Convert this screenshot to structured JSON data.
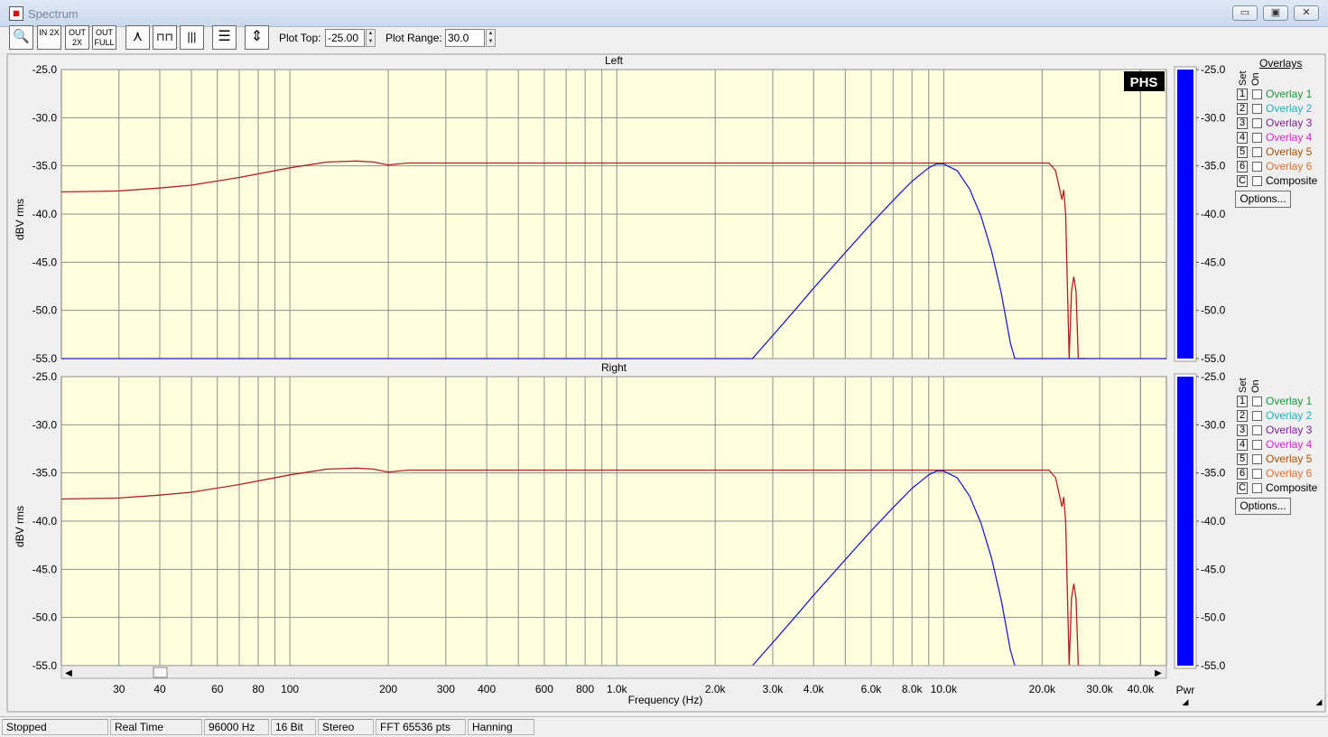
{
  "window": {
    "title": "Spectrum",
    "minimize": "▭",
    "maximize": "▣",
    "close": "✕"
  },
  "toolbar": {
    "buttons": [
      {
        "name": "zoom",
        "label": "🔍"
      },
      {
        "name": "in2x",
        "label": "IN 2X"
      },
      {
        "name": "out2x",
        "label": "OUT 2X"
      },
      {
        "name": "outfull",
        "label": "OUT FULL"
      },
      {
        "name": "peak",
        "label": "⋏"
      },
      {
        "name": "bars",
        "label": "⊓⊓"
      },
      {
        "name": "bargraph",
        "label": "|||"
      },
      {
        "name": "table",
        "label": "☰"
      },
      {
        "name": "range",
        "label": "⇕"
      }
    ],
    "plot_top_label": "Plot Top:",
    "plot_top_value": "-25.00",
    "plot_range_label": "Plot Range:",
    "plot_range_value": "30.0"
  },
  "chart_data": [
    {
      "type": "line",
      "title": "Left",
      "xlabel": "Frequency (Hz)",
      "ylabel": "dBV rms",
      "xscale": "log",
      "xlim": [
        20,
        48000
      ],
      "ylim": [
        -55,
        -25
      ],
      "yticks": [
        "-25.0",
        "-30.0",
        "-35.0",
        "-40.0",
        "-45.0",
        "-50.0",
        "-55.0"
      ],
      "xticks": [
        "30",
        "40",
        "60",
        "80",
        "100",
        "200",
        "300",
        "400",
        "600",
        "800",
        "1.0k",
        "2.0k",
        "3.0k",
        "4.0k",
        "6.0k",
        "8.0k",
        "10.0k",
        "20.0k",
        "30.0k",
        "40.0k"
      ],
      "xtick_values": [
        30,
        40,
        60,
        80,
        100,
        200,
        300,
        400,
        600,
        800,
        1000,
        2000,
        3000,
        4000,
        6000,
        8000,
        10000,
        20000,
        30000,
        40000
      ],
      "series": [
        {
          "color": "#b02020",
          "x": [
            20,
            30,
            40,
            50,
            70,
            100,
            130,
            160,
            180,
            200,
            230,
            300,
            1000,
            5000,
            10000,
            20000,
            21000,
            22000,
            23000,
            23300,
            23600,
            24200,
            24600,
            25000,
            25400,
            25800,
            26000,
            27000
          ],
          "y": [
            -37.7,
            -37.6,
            -37.3,
            -37.0,
            -36.2,
            -35.2,
            -34.6,
            -34.5,
            -34.6,
            -34.9,
            -34.7,
            -34.7,
            -34.7,
            -34.7,
            -34.7,
            -34.7,
            -34.7,
            -35.5,
            -38.5,
            -37.5,
            -40,
            -55,
            -48,
            -46.5,
            -48,
            -55,
            -55,
            -55
          ]
        },
        {
          "color": "#2020c0",
          "x": [
            20,
            2600,
            3000,
            3500,
            4000,
            5000,
            6000,
            7000,
            8000,
            9000,
            9500,
            10000,
            11000,
            12000,
            13000,
            14000,
            15000,
            16000,
            16500,
            17000,
            48000
          ],
          "y": [
            -55,
            -55,
            -52.6,
            -50.0,
            -47.7,
            -44.0,
            -41.0,
            -38.6,
            -36.6,
            -35.2,
            -34.8,
            -34.8,
            -35.5,
            -37.4,
            -40.2,
            -43.8,
            -48.2,
            -53.4,
            -55,
            -55,
            -55
          ]
        }
      ],
      "logo": "PHS"
    },
    {
      "type": "line",
      "title": "Right",
      "xlabel": "Frequency (Hz)",
      "ylabel": "dBV rms",
      "xscale": "log",
      "xlim": [
        20,
        48000
      ],
      "ylim": [
        -55,
        -25
      ],
      "yticks": [
        "-25.0",
        "-30.0",
        "-35.0",
        "-40.0",
        "-45.0",
        "-50.0",
        "-55.0"
      ],
      "series": [
        {
          "color": "#b02020",
          "x": [
            20,
            30,
            40,
            50,
            70,
            100,
            130,
            160,
            180,
            200,
            230,
            300,
            1000,
            5000,
            10000,
            20000,
            21000,
            22000,
            23000,
            23300,
            23600,
            24200,
            24600,
            25000,
            25400,
            25800,
            26000,
            27000
          ],
          "y": [
            -37.7,
            -37.6,
            -37.3,
            -37.0,
            -36.2,
            -35.2,
            -34.6,
            -34.5,
            -34.6,
            -34.9,
            -34.7,
            -34.7,
            -34.7,
            -34.7,
            -34.7,
            -34.7,
            -34.7,
            -35.5,
            -38.5,
            -37.5,
            -40,
            -55,
            -48,
            -46.5,
            -48,
            -55,
            -55,
            -55
          ]
        },
        {
          "color": "#2020c0",
          "x": [
            20,
            2600,
            3000,
            3500,
            4000,
            5000,
            6000,
            7000,
            8000,
            9000,
            9500,
            10000,
            11000,
            12000,
            13000,
            14000,
            15000,
            16000,
            16500,
            17000,
            48000
          ],
          "y": [
            -55,
            -55,
            -52.6,
            -50.0,
            -47.7,
            -44.0,
            -41.0,
            -38.6,
            -36.6,
            -35.2,
            -34.8,
            -34.8,
            -35.5,
            -37.4,
            -40.2,
            -43.8,
            -48.2,
            -53.4,
            -55,
            -55,
            -55
          ]
        }
      ]
    }
  ],
  "pwr": {
    "label": "Pwr",
    "ticks": [
      "-25.0",
      "-30.0",
      "-35.0",
      "-40.0",
      "-45.0",
      "-50.0",
      "-55.0"
    ],
    "color": "#0000ff"
  },
  "overlays": {
    "header": "Overlays",
    "set_label": "Set",
    "on_label": "On",
    "items": [
      {
        "set": "1",
        "label": "Overlay 1",
        "color": "#1a9a3a"
      },
      {
        "set": "2",
        "label": "Overlay 2",
        "color": "#20b0c0"
      },
      {
        "set": "3",
        "label": "Overlay 3",
        "color": "#8020a0"
      },
      {
        "set": "4",
        "label": "Overlay 4",
        "color": "#e020e0"
      },
      {
        "set": "5",
        "label": "Overlay 5",
        "color": "#b05000"
      },
      {
        "set": "6",
        "label": "Overlay 6",
        "color": "#e07030"
      },
      {
        "set": "C",
        "label": "Composite",
        "color": "#000000"
      }
    ],
    "options_label": "Options..."
  },
  "status": {
    "state": "Stopped",
    "mode": "Real Time",
    "rate": "96000 Hz",
    "bits": "16 Bit",
    "channels": "Stereo",
    "fft": "FFT 65536 pts",
    "window": "Hanning"
  }
}
